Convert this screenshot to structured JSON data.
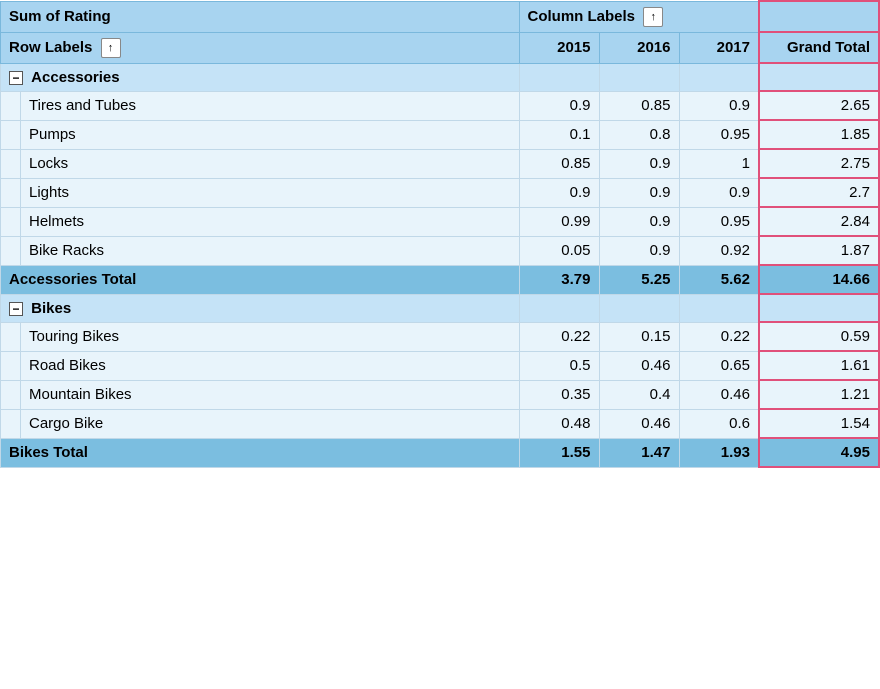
{
  "header": {
    "sum_of_rating": "Sum of Rating",
    "column_labels": "Column Labels",
    "row_labels": "Row Labels",
    "col_2015": "2015",
    "col_2016": "2016",
    "col_2017": "2017",
    "col_grand_total": "Grand Total"
  },
  "categories": [
    {
      "name": "Accessories",
      "items": [
        {
          "label": "Tires and Tubes",
          "v2015": "0.9",
          "v2016": "0.85",
          "v2017": "0.9",
          "grand_total": "2.65"
        },
        {
          "label": "Pumps",
          "v2015": "0.1",
          "v2016": "0.8",
          "v2017": "0.95",
          "grand_total": "1.85"
        },
        {
          "label": "Locks",
          "v2015": "0.85",
          "v2016": "0.9",
          "v2017": "1",
          "grand_total": "2.75"
        },
        {
          "label": "Lights",
          "v2015": "0.9",
          "v2016": "0.9",
          "v2017": "0.9",
          "grand_total": "2.7"
        },
        {
          "label": "Helmets",
          "v2015": "0.99",
          "v2016": "0.9",
          "v2017": "0.95",
          "grand_total": "2.84"
        },
        {
          "label": "Bike Racks",
          "v2015": "0.05",
          "v2016": "0.9",
          "v2017": "0.92",
          "grand_total": "1.87"
        }
      ],
      "total_label": "Accessories Total",
      "t2015": "3.79",
      "t2016": "5.25",
      "t2017": "5.62",
      "t_grand": "14.66"
    },
    {
      "name": "Bikes",
      "items": [
        {
          "label": "Touring Bikes",
          "v2015": "0.22",
          "v2016": "0.15",
          "v2017": "0.22",
          "grand_total": "0.59"
        },
        {
          "label": "Road Bikes",
          "v2015": "0.5",
          "v2016": "0.46",
          "v2017": "0.65",
          "grand_total": "1.61"
        },
        {
          "label": "Mountain Bikes",
          "v2015": "0.35",
          "v2016": "0.4",
          "v2017": "0.46",
          "grand_total": "1.21"
        },
        {
          "label": "Cargo Bike",
          "v2015": "0.48",
          "v2016": "0.46",
          "v2017": "0.6",
          "grand_total": "1.54"
        }
      ],
      "total_label": "Bikes Total",
      "t2015": "1.55",
      "t2016": "1.47",
      "t2017": "1.93",
      "t_grand": "4.95"
    }
  ],
  "sort_up_symbol": "↑",
  "collapse_symbol": "−"
}
